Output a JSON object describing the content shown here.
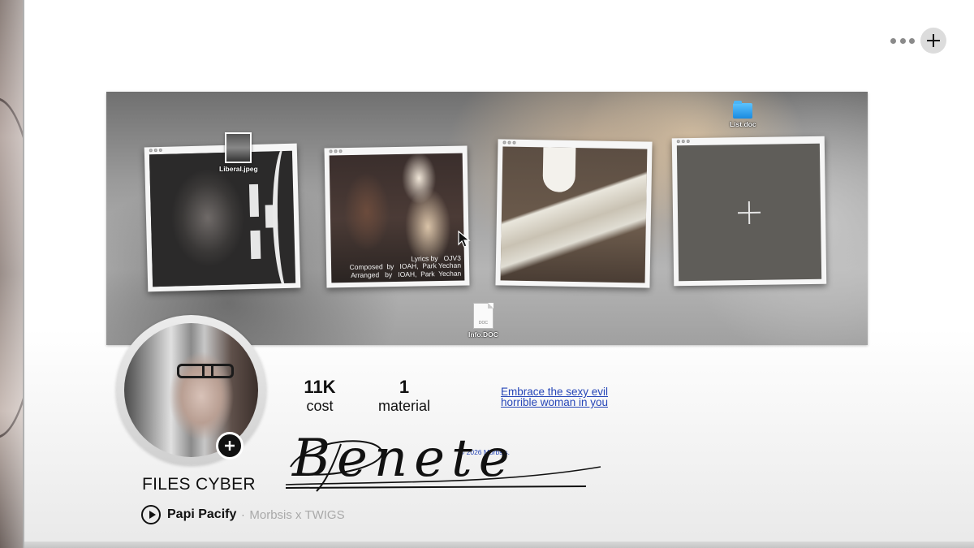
{
  "header": {
    "more_icon": "ellipsis-icon",
    "add_icon": "plus-icon"
  },
  "banner": {
    "windows": [
      {
        "name": "photo-window-1"
      },
      {
        "name": "photo-window-2",
        "credits": "Lyrics by   OJV3\nComposed  by   IOAH,  Park Yechan\nArranged   by   IOAH,  Park  Yechan"
      },
      {
        "name": "photo-window-3"
      },
      {
        "name": "empty-add-window",
        "icon": "plus-icon"
      }
    ],
    "desktop_icons": {
      "liberal": "Liberal.jpeg",
      "list": "List.doc",
      "info": "Info.DOC",
      "info_badge": "DOC"
    }
  },
  "profile": {
    "name": "FILES CYBER",
    "signature": "Benete",
    "copyright": "© 2026 Morbsis.",
    "tagline": "Embrace the sexy evil horrible woman in you",
    "stats": {
      "cost_value": "11K",
      "cost_label": "cost",
      "material_value": "1",
      "material_label": "material"
    },
    "now_playing": {
      "track": "Papi Pacify",
      "separator": "·",
      "artist": "Morbsis x TWIGS"
    }
  },
  "colors": {
    "link": "#2646b8",
    "text": "#111111",
    "muted": "#a9a9a9",
    "folder": "#1a8ae0"
  }
}
